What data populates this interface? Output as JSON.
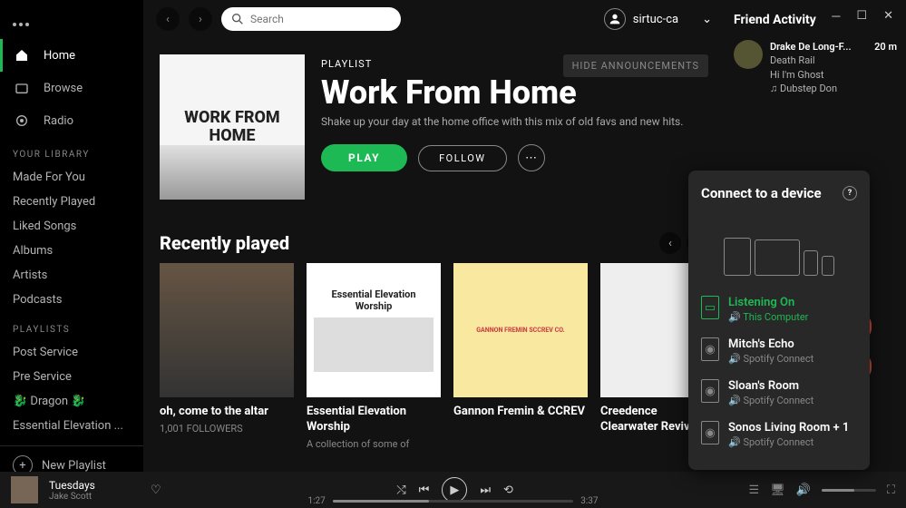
{
  "window": {
    "user": "sirtuc-ca"
  },
  "search": {
    "placeholder": "Search"
  },
  "sidebar": {
    "nav": [
      {
        "label": "Home"
      },
      {
        "label": "Browse"
      },
      {
        "label": "Radio"
      }
    ],
    "section1_title": "YOUR LIBRARY",
    "library": [
      "Made For You",
      "Recently Played",
      "Liked Songs",
      "Albums",
      "Artists",
      "Podcasts"
    ],
    "section2_title": "PLAYLISTS",
    "playlists": [
      "Post Service",
      "Pre Service",
      "🐉 Dragon 🐉",
      "Essential Elevation ..."
    ],
    "new_playlist": "New Playlist"
  },
  "hero": {
    "cover_text": "WORK FROM HOME",
    "type": "PLAYLIST",
    "title": "Work From Home",
    "desc": "Shake up your day at the home office with this mix of old favs and new hits.",
    "hide": "HIDE ANNOUNCEMENTS",
    "play": "PLAY",
    "follow": "FOLLOW"
  },
  "recently": {
    "title": "Recently played",
    "cards": [
      {
        "title": "oh, come to the altar",
        "sub": "1,001 FOLLOWERS"
      },
      {
        "title": "Essential Elevation Worship",
        "sub": "A collection of some of"
      },
      {
        "title": "Gannon Fremin & CCREV",
        "sub": ""
      },
      {
        "title": "Creedence Clearwater Revival",
        "sub": ""
      }
    ]
  },
  "friend": {
    "title": "Friend Activity",
    "name": "Drake De Long-F...",
    "time": "20 m",
    "track": "Death Rail",
    "artist": "Hi I'm Ghost",
    "playlist": "Dubstep Don"
  },
  "connect": {
    "title": "Connect to a device",
    "listening": "Listening On",
    "this_computer": "This Computer",
    "devices": [
      {
        "name": "Mitch's Echo",
        "sub": "Spotify Connect"
      },
      {
        "name": "Sloan's Room",
        "sub": "Spotify Connect"
      },
      {
        "name": "Sonos Living Room + 1",
        "sub": "Spotify Connect"
      }
    ]
  },
  "player": {
    "title": "Tuesdays",
    "artist": "Jake Scott",
    "elapsed": "1:27",
    "duration": "3:37"
  }
}
